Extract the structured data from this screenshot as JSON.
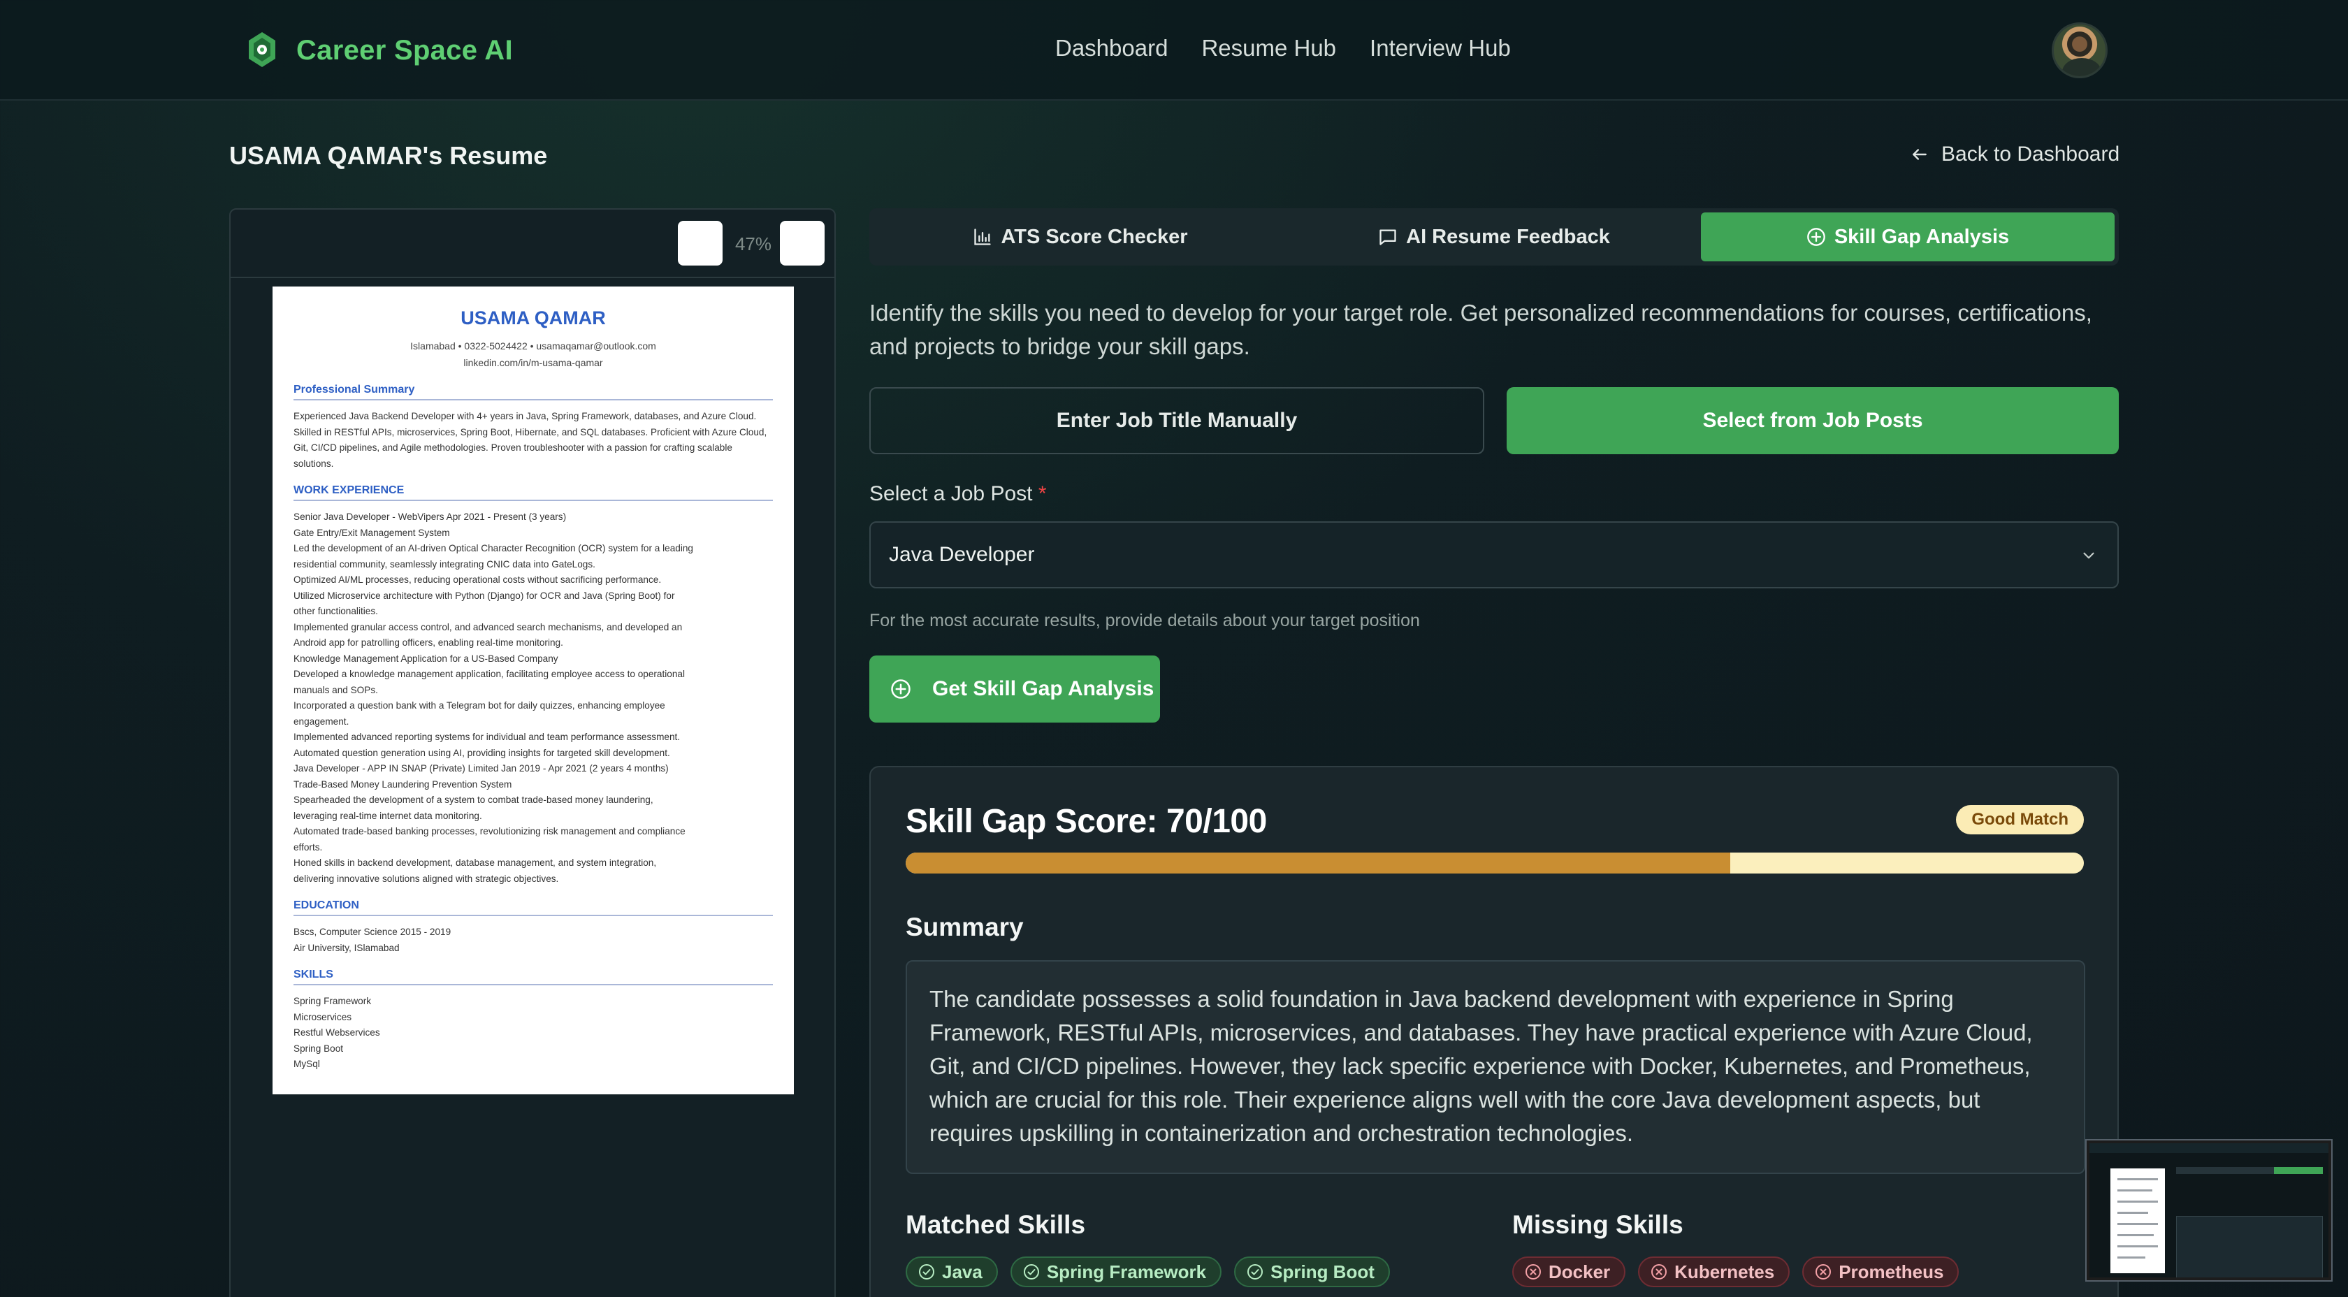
{
  "nav": {
    "brand": "Career Space AI",
    "links": [
      "Dashboard",
      "Resume Hub",
      "Interview Hub"
    ]
  },
  "header": {
    "title": "USAMA QAMAR's Resume",
    "back_label": "Back to Dashboard"
  },
  "viewer": {
    "zoom": "47%"
  },
  "resume": {
    "name": "USAMA QAMAR",
    "contact_line1": "Islamabad  •  0322-5024422  •  usamaqamar@outlook.com",
    "contact_line2": "linkedin.com/in/m-usama-qamar",
    "summary_heading": "Professional Summary",
    "summary_text": "Experienced Java Backend Developer with 4+ years in Java, Spring Framework, databases, and Azure Cloud. Skilled in RESTful APIs, microservices, Spring Boot, Hibernate, and SQL databases. Proficient with Azure Cloud, Git, CI/CD pipelines, and Agile methodologies. Proven troubleshooter with a passion for crafting scalable solutions.",
    "experience_heading": "WORK EXPERIENCE",
    "experience_lines": [
      "Senior Java Developer - WebVipers Apr 2021 - Present (3 years)",
      "Gate Entry/Exit Management System",
      "Led the development of an AI-driven Optical Character Recognition (OCR) system for a leading",
      "residential community, seamlessly integrating CNIC data into GateLogs.",
      "Optimized AI/ML processes, reducing operational costs without sacrificing performance.",
      "Utilized Microservice architecture with Python (Django) for OCR and Java (Spring Boot) for",
      "other functionalities.",
      "Implemented granular access control, and advanced search mechanisms, and developed an",
      "Android app for patrolling officers, enabling real-time monitoring.",
      "Knowledge Management Application for a US-Based Company",
      "Developed a knowledge management application, facilitating employee access to operational",
      "manuals and SOPs.",
      "Incorporated a question bank with a Telegram bot for daily quizzes, enhancing employee",
      "engagement.",
      "Implemented advanced reporting systems for individual and team performance assessment.",
      "Automated question generation using AI, providing insights for targeted skill development.",
      "Java Developer - APP IN SNAP (Private) Limited Jan 2019 - Apr 2021 (2 years 4 months)",
      "Trade-Based Money Laundering Prevention System",
      "Spearheaded the development of a system to combat trade-based money laundering,",
      "leveraging real-time internet data monitoring.",
      "Automated trade-based banking processes, revolutionizing risk management and compliance",
      "efforts.",
      "Honed skills in backend development, database management, and system integration,",
      "delivering innovative solutions aligned with strategic objectives."
    ],
    "education_heading": "EDUCATION",
    "education_lines": [
      "Bscs, Computer Science 2015 - 2019",
      "Air University, ISlamabad"
    ],
    "skills_heading": "SKILLS",
    "skills_lines": [
      "Spring Framework",
      "Microservices",
      "Restful Webservices",
      "Spring Boot",
      "MySql"
    ]
  },
  "tabs": [
    {
      "label": "ATS Score Checker",
      "icon": "bar-chart-icon"
    },
    {
      "label": "AI Resume Feedback",
      "icon": "message-icon"
    },
    {
      "label": "Skill Gap Analysis",
      "icon": "plus-circle-icon",
      "active": true
    }
  ],
  "intro": "Identify the skills you need to develop for your target role. Get personalized recommendations for courses, certifications, and projects to bridge your skill gaps.",
  "mode": {
    "manual_label": "Enter Job Title Manually",
    "posts_label": "Select from Job Posts",
    "selected": "posts"
  },
  "job_select": {
    "label": "Select a Job Post",
    "required_mark": "*",
    "value": "Java Developer",
    "hint": "For the most accurate results, provide details about your target position"
  },
  "cta_label": "Get Skill Gap Analysis",
  "result": {
    "score_title": "Skill Gap Score: 70/100",
    "score": 70,
    "score_max": 100,
    "badge": "Good Match",
    "summary_heading": "Summary",
    "summary_text": "The candidate possesses a solid foundation in Java backend development with experience in Spring Framework, RESTful APIs, microservices, and databases. They have practical experience with Azure Cloud, Git, and CI/CD pipelines. However, they lack specific experience with Docker, Kubernetes, and Prometheus, which are crucial for this role. Their experience aligns well with the core Java development aspects, but requires upskilling in containerization and orchestration technologies.",
    "matched_heading": "Matched Skills",
    "matched": [
      "Java",
      "Spring Framework",
      "Spring Boot"
    ],
    "missing_heading": "Missing Skills",
    "missing": [
      "Docker",
      "Kubernetes",
      "Prometheus"
    ]
  },
  "colors": {
    "accent": "#3fa556",
    "brand": "#5fcf73",
    "score_bar": "#c98e32",
    "score_track": "#fbefbd",
    "matched_chip": "#1f3e2c",
    "missing_chip": "#3d2024"
  }
}
